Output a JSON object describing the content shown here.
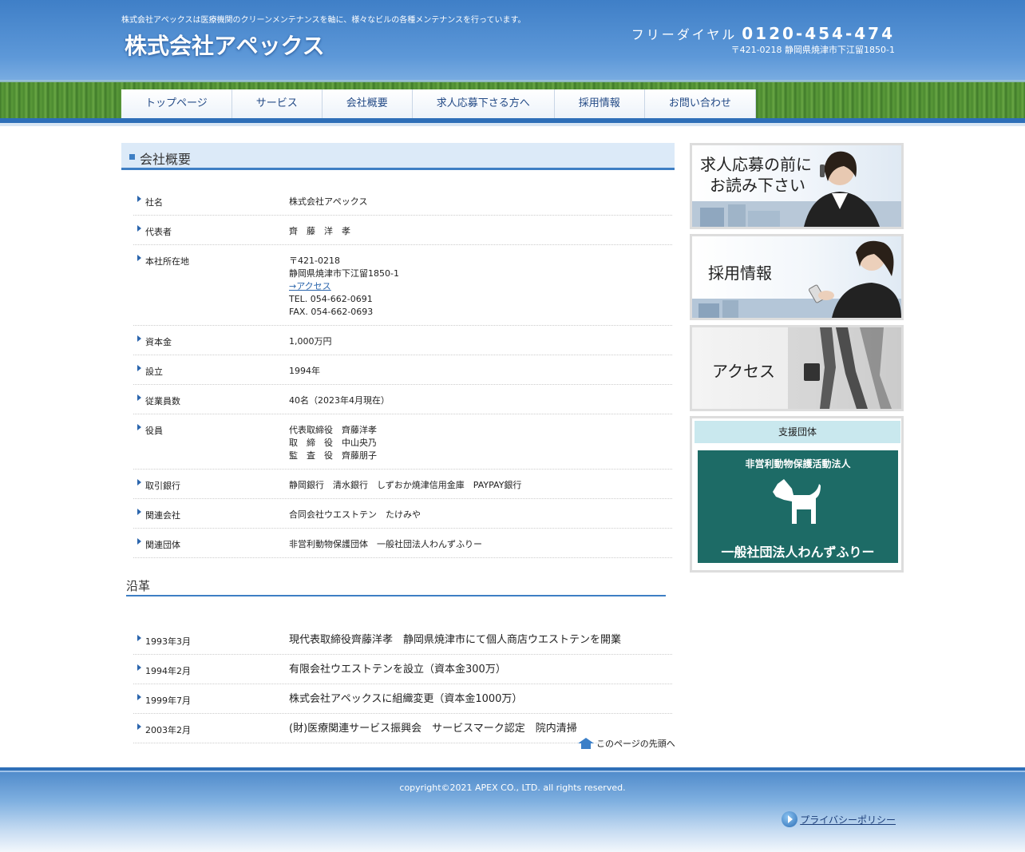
{
  "header": {
    "tagline": "株式会社アペックスは医療機関のクリーンメンテナンスを軸に、様々なビルの各種メンテナンスを行っています。",
    "logo": "株式会社アペックス",
    "phone_label": "フリーダイヤル",
    "phone_number": "0120-454-474",
    "address": "〒421-0218 静岡県焼津市下江留1850-1"
  },
  "nav": {
    "items": [
      "トップページ",
      "サービス",
      "会社概要",
      "求人応募下さる方へ",
      "採用情報",
      "お問い合わせ"
    ]
  },
  "main": {
    "title": "会社概要",
    "company": [
      {
        "label": "社名",
        "lines": [
          "株式会社アペックス"
        ]
      },
      {
        "label": "代表者",
        "lines": [
          "齊　藤　洋　孝"
        ]
      },
      {
        "label": "本社所在地",
        "lines": [
          "〒421-0218",
          "静岡県焼津市下江留1850-1"
        ],
        "link": "→アクセス",
        "after": [
          "TEL. 054-662-0691",
          "FAX. 054-662-0693"
        ]
      },
      {
        "label": "資本金",
        "lines": [
          "1,000万円"
        ]
      },
      {
        "label": "設立",
        "lines": [
          "1994年"
        ]
      },
      {
        "label": "従業員数",
        "lines": [
          "40名（2023年4月現在）"
        ]
      },
      {
        "label": "役員",
        "lines": [
          "代表取締役　齊藤洋孝",
          "取　締　役　中山央乃",
          "監　査　役　齊藤朋子"
        ]
      },
      {
        "label": "取引銀行",
        "lines": [
          "静岡銀行　清水銀行　しずおか焼津信用金庫　PAYPAY銀行"
        ]
      },
      {
        "label": "関連会社",
        "lines": [
          "合同会社ウエストテン　たけみや"
        ]
      },
      {
        "label": "関連団体",
        "lines": [
          "非営利動物保護団体　一般社団法人わんずふりー"
        ]
      }
    ],
    "history_title": "沿革",
    "history": [
      {
        "date": "1993年3月",
        "text": "現代表取締役齊藤洋孝　静岡県焼津市にて個人商店ウエストテンを開業"
      },
      {
        "date": "1994年2月",
        "text": "有限会社ウエストテンを設立（資本金300万）"
      },
      {
        "date": "1999年7月",
        "text": "株式会社アペックスに組織変更（資本金1000万）"
      },
      {
        "date": "2003年2月",
        "text": "(財)医療関連サービス振興会　サービスマーク認定　院内清掃"
      }
    ],
    "page_top": "このページの先頭へ"
  },
  "sidebar": {
    "banner1_line1": "求人応募の前に",
    "banner1_line2": "お読み下さい",
    "banner2": "採用情報",
    "banner3": "アクセス",
    "support_title": "支援団体",
    "support_line1": "非営利動物保護活動法人",
    "support_line2": "一般社団法人わんずふりー"
  },
  "footer": {
    "copyright": "copyright©2021 APEX CO., LTD. all rights reserved.",
    "privacy": "プライバシーポリシー"
  },
  "colors": {
    "accent": "#3e7fc4",
    "nav_text": "#234a86",
    "support_bg": "#1d6b66"
  }
}
